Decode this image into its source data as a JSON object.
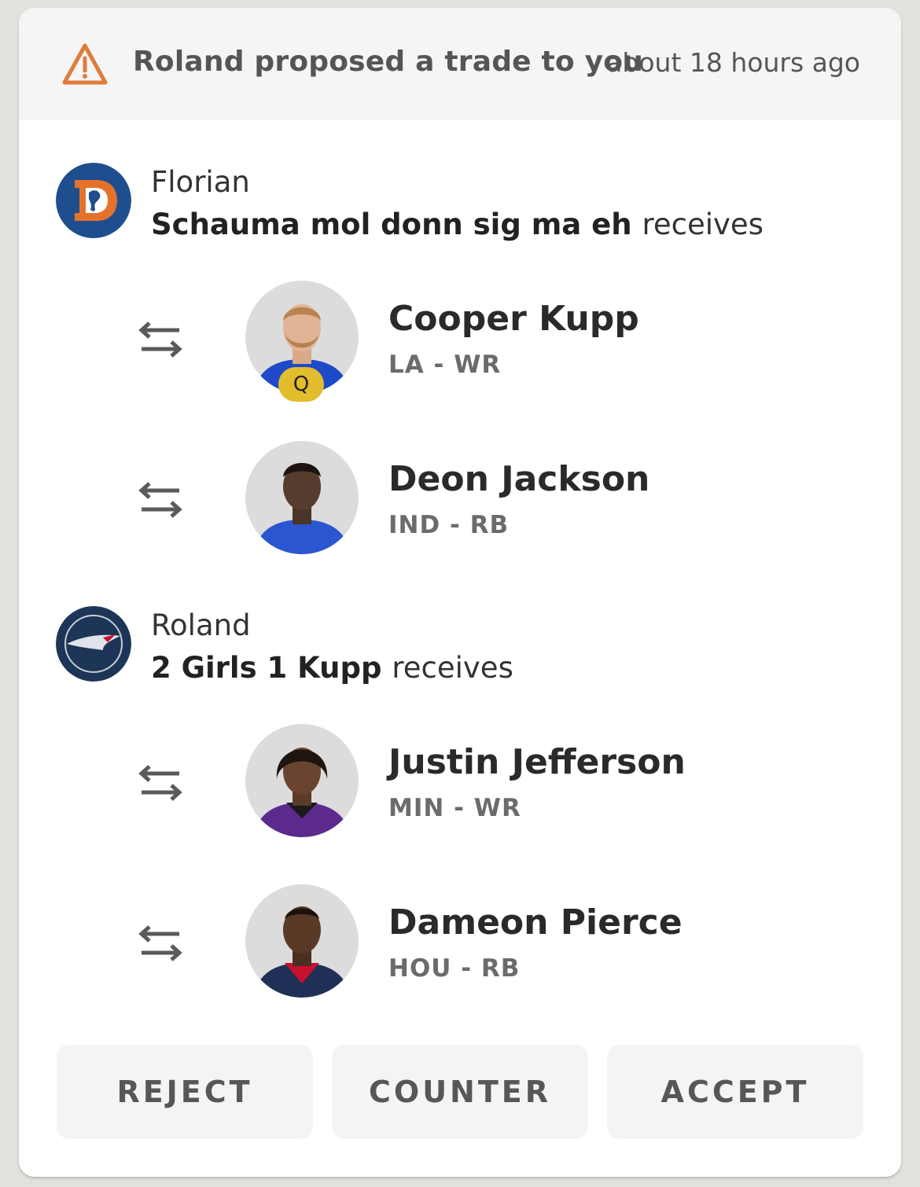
{
  "header": {
    "title": "Roland proposed a trade to you",
    "time": "about 18 hours ago",
    "warn_color": "#e07b39"
  },
  "teams": [
    {
      "owner": "Florian",
      "team_name": "Schauma mol donn sig ma eh",
      "receives_label": "receives",
      "logo": "broncos-logo",
      "players": [
        {
          "name": "Cooper Kupp",
          "meta": "LA - WR",
          "status": "Q",
          "jersey_color": "#1e49c8"
        },
        {
          "name": "Deon Jackson",
          "meta": "IND - RB",
          "status": "",
          "jersey_color": "#2a57d0"
        }
      ]
    },
    {
      "owner": "Roland",
      "team_name": "2 Girls 1 Kupp",
      "receives_label": "receives",
      "logo": "patriots-logo",
      "players": [
        {
          "name": "Justin Jefferson",
          "meta": "MIN - WR",
          "status": "",
          "jersey_color": "#5b2a8c"
        },
        {
          "name": "Dameon Pierce",
          "meta": "HOU - RB",
          "status": "",
          "jersey_color": "#1f2f55"
        }
      ]
    }
  ],
  "actions": {
    "reject": "REJECT",
    "counter": "COUNTER",
    "accept": "ACCEPT"
  }
}
